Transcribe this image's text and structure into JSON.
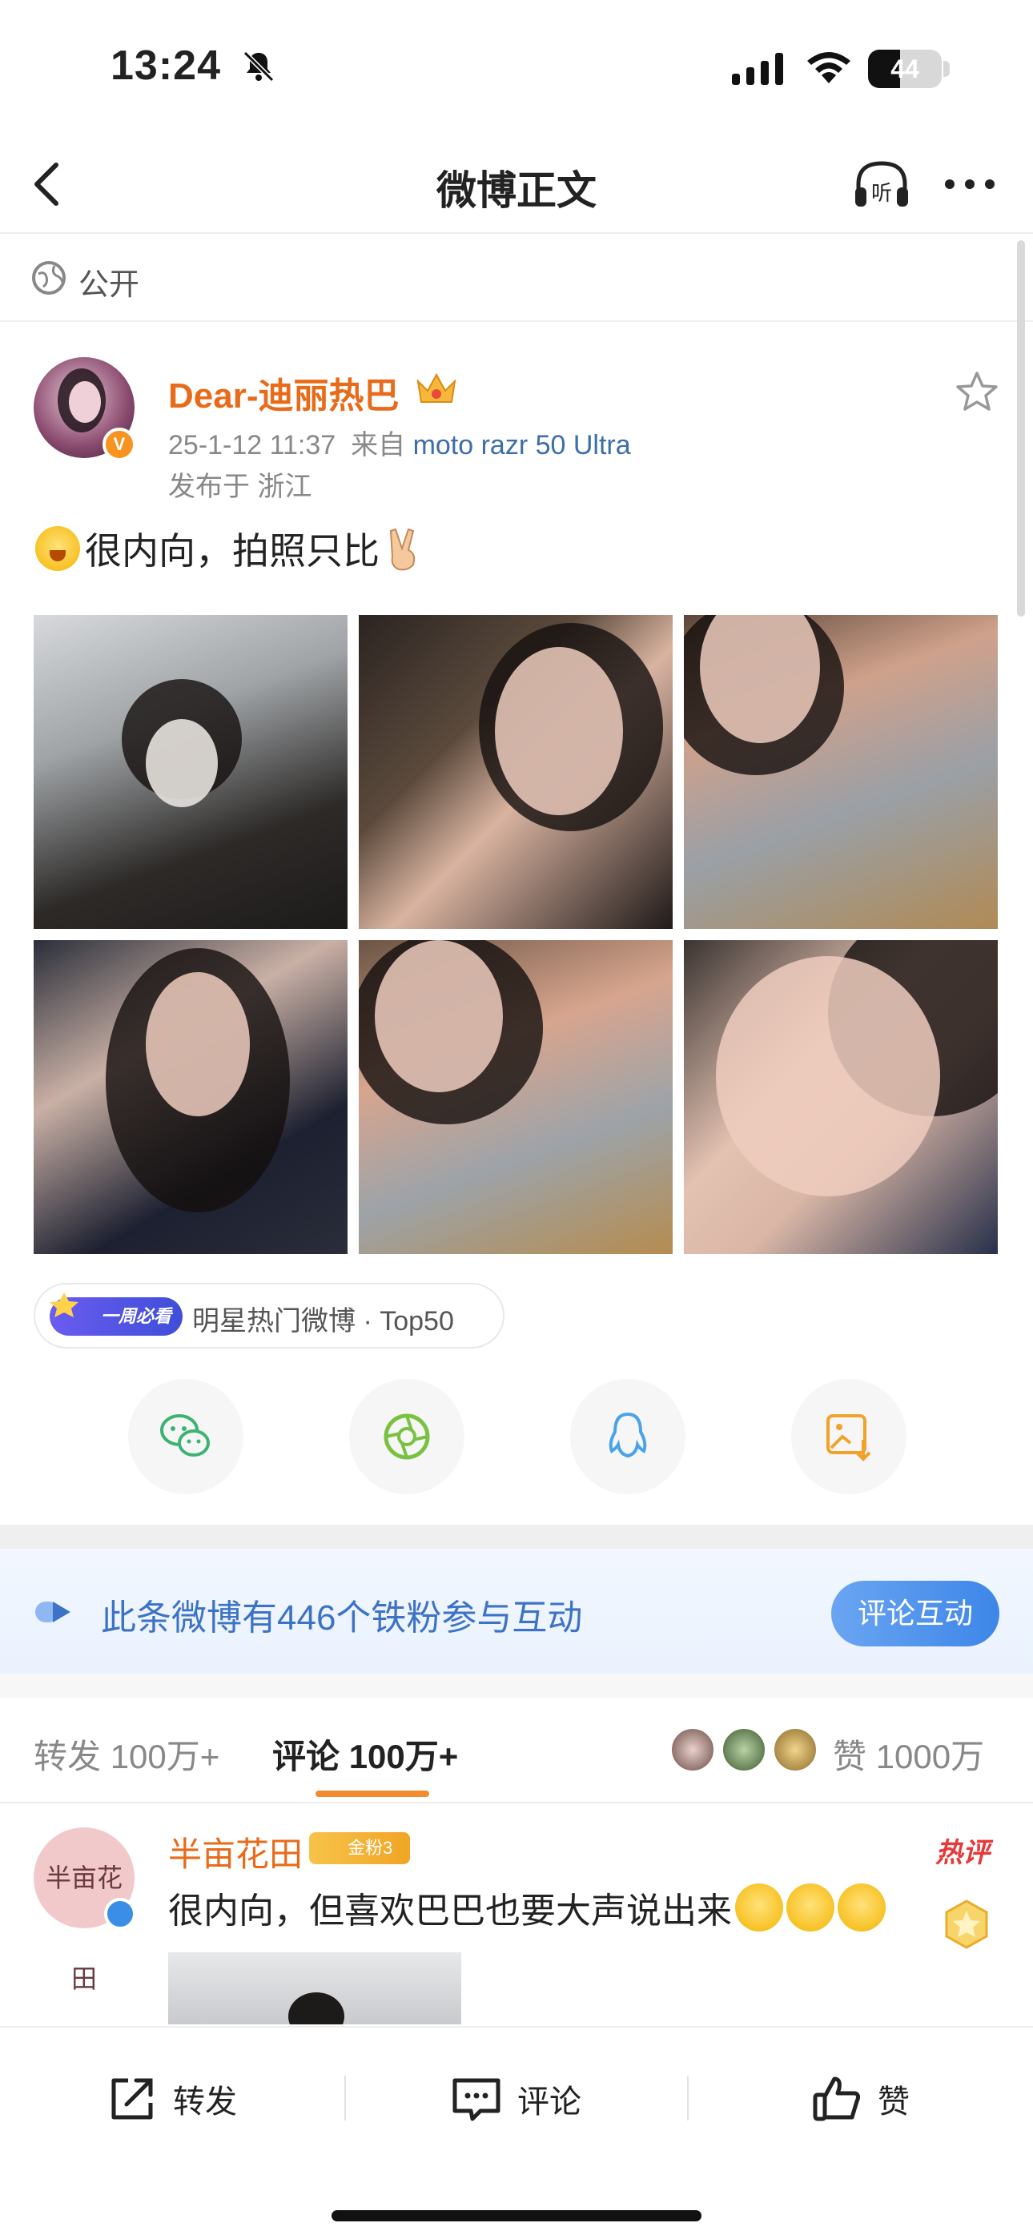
{
  "status_bar": {
    "time": "13:24",
    "battery": "44",
    "battery_level": 0.44
  },
  "nav": {
    "title": "微博正文"
  },
  "privacy": {
    "label": "公开"
  },
  "post": {
    "author": "Dear-迪丽热巴",
    "time": "25-1-12 11:37",
    "source_prefix": "来自",
    "device": "moto razr 50 Ultra",
    "location": "发布于 浙江",
    "text": "很内向，拍照只比",
    "image_count": 6
  },
  "hot": {
    "badge": "一周必看",
    "label": "明星热门微博 · Top50"
  },
  "share_icons": [
    "wechat-icon",
    "moments-icon",
    "qq-icon",
    "save-image-icon"
  ],
  "fans": {
    "text": "此条微博有446个铁粉参与互动",
    "button": "评论互动"
  },
  "tabs": {
    "repost_label": "转发",
    "repost_count": "100万+",
    "comment_label": "评论",
    "comment_count": "100万+",
    "like_label": "赞",
    "like_count": "1000万"
  },
  "comment": {
    "author": "半亩花田",
    "avatar_text": "半亩花田",
    "fan_badge": "金粉3",
    "hot_tag": "热评",
    "text": "很内向，但喜欢巴巴也要大声说出来"
  },
  "bottom": {
    "repost": "转发",
    "comment": "评论",
    "like": "赞"
  },
  "colors": {
    "orange": "#e86b1a",
    "blue": "#3d73c6",
    "accent": "#f28a30"
  }
}
